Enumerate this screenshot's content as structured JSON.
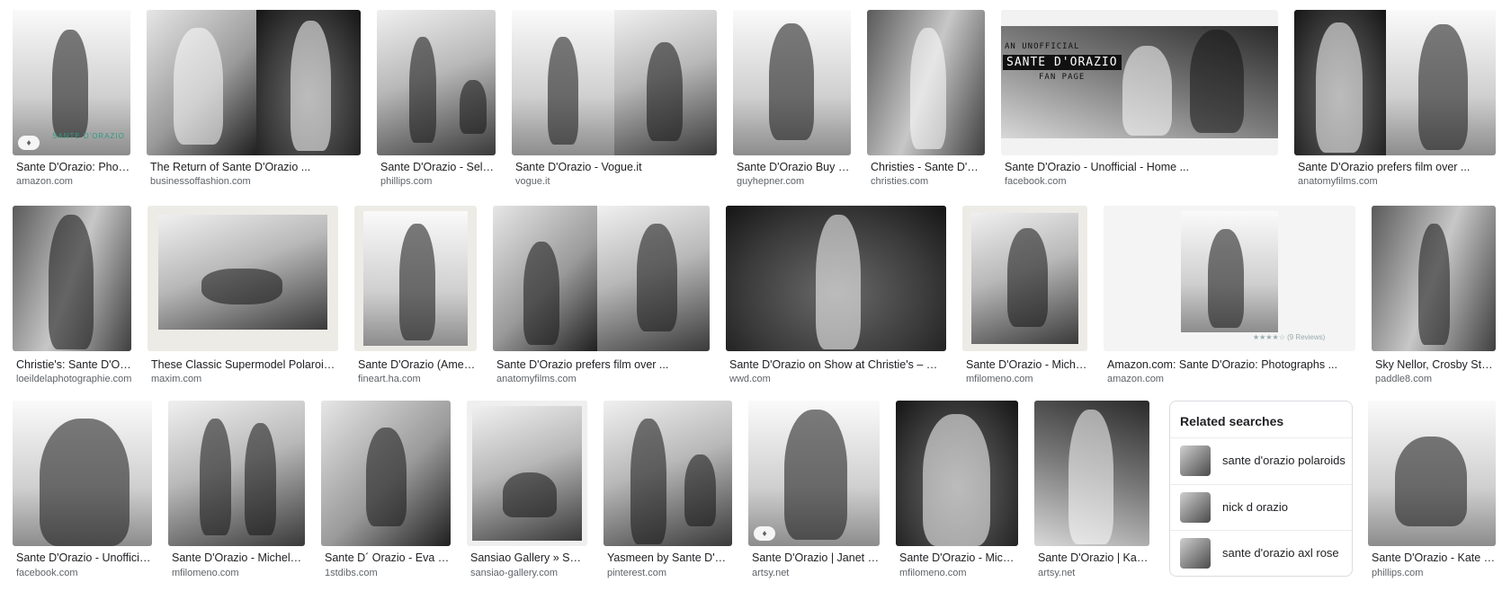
{
  "rows": [
    {
      "tiles": [
        {
          "title": "Sante D'Orazio: Photog...",
          "source": "amazon.com",
          "overlay_label": "SANTE D'ORAZIO",
          "tag_icon": "tag-icon"
        },
        {
          "title": "The Return of Sante D'Orazio ...",
          "source": "businessoffashion.com"
        },
        {
          "title": "Sante D'Orazio - Select...",
          "source": "phillips.com"
        },
        {
          "title": "Sante D'Orazio - Vogue.it",
          "source": "vogue.it"
        },
        {
          "title": "Sante D'Orazio Buy Fas...",
          "source": "guyhepner.com"
        },
        {
          "title": "Christies - Sante D'Oraz...",
          "source": "christies.com"
        },
        {
          "title": "Sante D'Orazio - Unofficial - Home ...",
          "source": "facebook.com",
          "overlay_top": "AN UNOFFICIAL",
          "overlay_mid": "SANTE D'ORAZIO",
          "overlay_bottom": "FAN PAGE"
        },
        {
          "title": "Sante D'Orazio prefers film over ...",
          "source": "anatomyfilms.com"
        }
      ]
    },
    {
      "tiles": [
        {
          "title": "Christie's: Sante D'Orazi...",
          "source": "loeildelaphotographie.com"
        },
        {
          "title": "These Classic Supermodel Polaroids ...",
          "source": "maxim.com"
        },
        {
          "title": "Sante D'Orazio (America...",
          "source": "fineart.ha.com"
        },
        {
          "title": "Sante D'Orazio prefers film over ...",
          "source": "anatomyfilms.com"
        },
        {
          "title": "Sante D'Orazio on Show at Christie's – WWD",
          "source": "wwd.com"
        },
        {
          "title": "Sante D'Orazio - Michele ...",
          "source": "mfilomeno.com"
        },
        {
          "title": "Amazon.com: Sante D'Orazio: Photographs ...",
          "source": "amazon.com",
          "rating_text": "★★★★☆ (9 Reviews)"
        },
        {
          "title": "Sky Nellor, Crosby St, NY...",
          "source": "paddle8.com"
        }
      ]
    },
    {
      "tiles": [
        {
          "title": "Sante D'Orazio - Unofficial - ...",
          "source": "facebook.com"
        },
        {
          "title": "Sante D'Orazio - Michele Fil...",
          "source": "mfilomeno.com"
        },
        {
          "title": "Sante D´ Orazio - Eva Men...",
          "source": "1stdibs.com"
        },
        {
          "title": "Sansiao Gallery » SANT...",
          "source": "sansiao-gallery.com"
        },
        {
          "title": "Yasmeen by Sante D'Oraz...",
          "source": "pinterest.com"
        },
        {
          "title": "Sante D'Orazio | Janet Jac...",
          "source": "artsy.net",
          "tag_icon": "tag-icon"
        },
        {
          "title": "Sante D'Orazio - Michele...",
          "source": "mfilomeno.com"
        },
        {
          "title": "Sante D'Orazio | Kate M...",
          "source": "artsy.net"
        },
        {
          "title": "Sante D'Orazio - Kate Mo...",
          "source": "phillips.com"
        }
      ]
    }
  ],
  "related_searches": {
    "heading": "Related searches",
    "items": [
      {
        "label": "sante d'orazio polaroids"
      },
      {
        "label": "nick d orazio"
      },
      {
        "label": "sante d'orazio axl rose"
      }
    ]
  }
}
